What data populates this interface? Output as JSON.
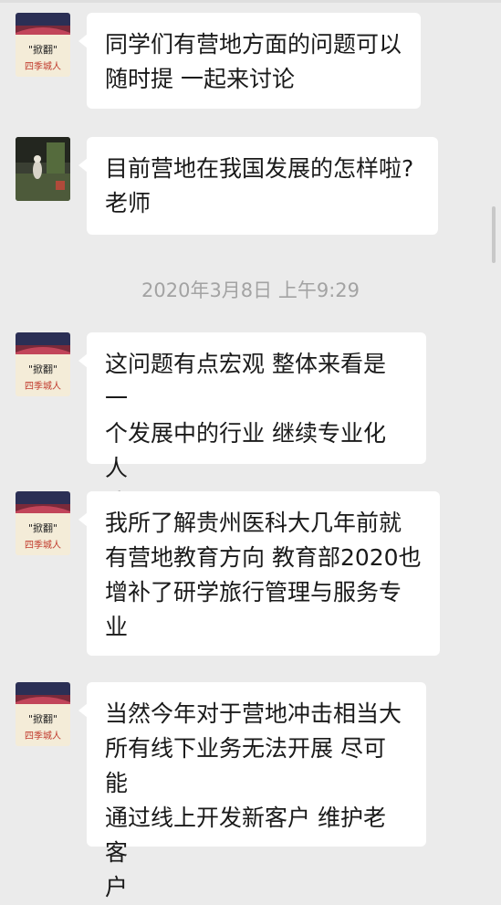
{
  "messages": [
    {
      "sender": "teacher",
      "text": "同学们有营地方面的问题可以\n随时提 一起来讨论"
    },
    {
      "sender": "student",
      "text": "目前营地在我国发展的怎样啦?\n老师"
    },
    {
      "sender": "teacher",
      "text": "这问题有点宏观 整体来看是一\n个发展中的行业 继续专业化人\n才"
    },
    {
      "sender": "teacher",
      "text": "我所了解贵州医科大几年前就\n有营地教育方向 教育部2020也\n增补了研学旅行管理与服务专\n业"
    },
    {
      "sender": "teacher",
      "text": "当然今年对于营地冲击相当大\n所有线下业务无法开展 尽可能\n通过线上开发新客户 维护老客\n户"
    }
  ],
  "timestamp": "2020年3月8日 上午9:29",
  "avatar_text": {
    "line1": "\"掀翻\"",
    "line2": "四季城人"
  },
  "colors": {
    "background": "#ebebeb",
    "bubble": "#ffffff",
    "text": "#1a1a1a",
    "timestamp": "#a3a3a3"
  }
}
